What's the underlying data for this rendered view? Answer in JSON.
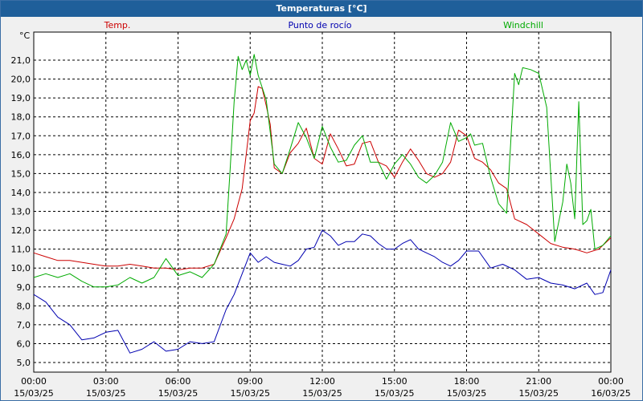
{
  "window": {
    "title": "Temperaturas [°C]"
  },
  "colors": {
    "temp": "#cc0000",
    "dew": "#0000b0",
    "windchill": "#00aa00",
    "grid": "#000000",
    "background": "#ffffff"
  },
  "chart_data": {
    "type": "line",
    "title": "Temperaturas [°C]",
    "ylabel": "°C",
    "xlabel": "",
    "ylim": [
      5.0,
      21.0
    ],
    "xlim_hours": [
      0,
      24
    ],
    "grid": true,
    "legend_placement": "top",
    "yticks": [
      "5,0",
      "6,0",
      "7,0",
      "8,0",
      "9,0",
      "10,0",
      "11,0",
      "12,0",
      "13,0",
      "14,0",
      "15,0",
      "16,0",
      "17,0",
      "18,0",
      "19,0",
      "20,0",
      "21,0"
    ],
    "xticks": [
      {
        "time": "00:00",
        "date": "15/03/25"
      },
      {
        "time": "03:00",
        "date": "15/03/25"
      },
      {
        "time": "06:00",
        "date": "15/03/25"
      },
      {
        "time": "09:00",
        "date": "15/03/25"
      },
      {
        "time": "12:00",
        "date": "15/03/25"
      },
      {
        "time": "15:00",
        "date": "15/03/25"
      },
      {
        "time": "18:00",
        "date": "15/03/25"
      },
      {
        "time": "21:00",
        "date": "15/03/25"
      },
      {
        "time": "00:00",
        "date": "16/03/25"
      }
    ],
    "series": [
      {
        "name": "Temp.",
        "color": "#cc0000",
        "x": [
          "00:00",
          "00:30",
          "01:00",
          "01:30",
          "02:00",
          "02:30",
          "03:00",
          "03:30",
          "04:00",
          "04:30",
          "05:00",
          "05:30",
          "06:00",
          "06:30",
          "07:00",
          "07:30",
          "08:00",
          "08:20",
          "08:40",
          "09:00",
          "09:10",
          "09:20",
          "09:30",
          "09:40",
          "09:50",
          "10:00",
          "10:20",
          "10:40",
          "11:00",
          "11:20",
          "11:40",
          "12:00",
          "12:20",
          "12:40",
          "13:00",
          "13:20",
          "13:40",
          "14:00",
          "14:20",
          "14:40",
          "15:00",
          "15:20",
          "15:40",
          "16:00",
          "16:20",
          "16:40",
          "17:00",
          "17:20",
          "17:40",
          "18:00",
          "18:20",
          "18:40",
          "19:00",
          "19:20",
          "19:40",
          "20:00",
          "20:30",
          "21:00",
          "21:30",
          "22:00",
          "22:30",
          "23:00",
          "23:30",
          "24:00"
        ],
        "values": [
          10.8,
          10.6,
          10.4,
          10.4,
          10.3,
          10.2,
          10.1,
          10.1,
          10.2,
          10.1,
          10.0,
          10.0,
          9.9,
          10.0,
          10.0,
          10.2,
          11.6,
          12.6,
          14.2,
          17.8,
          18.2,
          19.6,
          19.5,
          18.6,
          17.6,
          15.3,
          15.0,
          16.1,
          16.6,
          17.4,
          15.8,
          15.5,
          17.1,
          16.3,
          15.4,
          15.5,
          16.6,
          16.7,
          15.6,
          15.4,
          14.8,
          15.6,
          16.3,
          15.7,
          15.0,
          14.8,
          15.0,
          15.6,
          17.3,
          17.0,
          15.8,
          15.6,
          15.2,
          14.5,
          14.2,
          12.6,
          12.3,
          11.8,
          11.3,
          11.1,
          11.0,
          10.8,
          11.0,
          11.6
        ]
      },
      {
        "name": "Punto de rocío",
        "color": "#0000b0",
        "x": [
          "00:00",
          "00:30",
          "01:00",
          "01:30",
          "02:00",
          "02:30",
          "03:00",
          "03:30",
          "04:00",
          "04:30",
          "05:00",
          "05:30",
          "06:00",
          "06:30",
          "07:00",
          "07:30",
          "08:00",
          "08:20",
          "08:40",
          "09:00",
          "09:20",
          "09:40",
          "10:00",
          "10:20",
          "10:40",
          "11:00",
          "11:20",
          "11:40",
          "12:00",
          "12:20",
          "12:40",
          "13:00",
          "13:20",
          "13:40",
          "14:00",
          "14:20",
          "14:40",
          "15:00",
          "15:20",
          "15:40",
          "16:00",
          "16:20",
          "16:40",
          "17:00",
          "17:20",
          "17:40",
          "18:00",
          "18:30",
          "19:00",
          "19:30",
          "20:00",
          "20:30",
          "21:00",
          "21:30",
          "22:00",
          "22:30",
          "23:00",
          "23:20",
          "23:40",
          "24:00"
        ],
        "values": [
          8.6,
          8.2,
          7.4,
          7.0,
          6.2,
          6.3,
          6.6,
          6.7,
          5.5,
          5.7,
          6.1,
          5.6,
          5.7,
          6.1,
          6.0,
          6.1,
          7.8,
          8.6,
          9.7,
          10.8,
          10.3,
          10.6,
          10.3,
          10.2,
          10.1,
          10.4,
          11.0,
          11.1,
          12.0,
          11.7,
          11.2,
          11.4,
          11.4,
          11.8,
          11.7,
          11.3,
          11.0,
          11.0,
          11.3,
          11.5,
          11.0,
          10.8,
          10.6,
          10.3,
          10.1,
          10.4,
          10.9,
          10.9,
          10.0,
          10.2,
          9.9,
          9.4,
          9.5,
          9.2,
          9.1,
          8.9,
          9.2,
          8.6,
          8.7,
          9.9
        ]
      },
      {
        "name": "Windchill",
        "color": "#00aa00",
        "x": [
          "00:00",
          "00:30",
          "01:00",
          "01:30",
          "02:00",
          "02:30",
          "03:00",
          "03:30",
          "04:00",
          "04:30",
          "05:00",
          "05:30",
          "06:00",
          "06:30",
          "07:00",
          "07:30",
          "08:00",
          "08:10",
          "08:20",
          "08:30",
          "08:40",
          "08:50",
          "09:00",
          "09:10",
          "09:20",
          "09:40",
          "10:00",
          "10:20",
          "10:40",
          "11:00",
          "11:20",
          "11:40",
          "12:00",
          "12:20",
          "12:40",
          "13:00",
          "13:20",
          "13:40",
          "14:00",
          "14:20",
          "14:40",
          "15:00",
          "15:20",
          "15:40",
          "16:00",
          "16:20",
          "16:40",
          "17:00",
          "17:20",
          "17:40",
          "18:00",
          "18:10",
          "18:20",
          "18:40",
          "19:00",
          "19:20",
          "19:40",
          "20:00",
          "20:10",
          "20:20",
          "20:40",
          "21:00",
          "21:20",
          "21:40",
          "22:00",
          "22:10",
          "22:20",
          "22:30",
          "22:40",
          "22:50",
          "23:00",
          "23:10",
          "23:20",
          "23:30",
          "23:40",
          "24:00"
        ],
        "values": [
          9.5,
          9.7,
          9.5,
          9.7,
          9.3,
          9.0,
          9.0,
          9.1,
          9.5,
          9.2,
          9.5,
          10.5,
          9.6,
          9.8,
          9.5,
          10.2,
          11.8,
          15.2,
          18.8,
          21.2,
          20.5,
          21.0,
          20.2,
          21.3,
          20.2,
          18.9,
          15.5,
          15.0,
          16.3,
          17.7,
          16.9,
          15.8,
          17.5,
          16.4,
          15.6,
          15.7,
          16.5,
          17.0,
          15.6,
          15.6,
          14.7,
          15.5,
          16.0,
          15.5,
          14.8,
          14.5,
          14.9,
          15.6,
          17.7,
          16.7,
          16.9,
          17.1,
          16.5,
          16.6,
          14.8,
          13.4,
          12.9,
          20.3,
          19.7,
          20.6,
          20.5,
          20.3,
          18.5,
          11.4,
          13.5,
          15.5,
          14.5,
          12.6,
          18.8,
          12.3,
          12.5,
          13.1,
          11.0,
          11.1,
          11.2,
          11.7
        ]
      }
    ]
  }
}
